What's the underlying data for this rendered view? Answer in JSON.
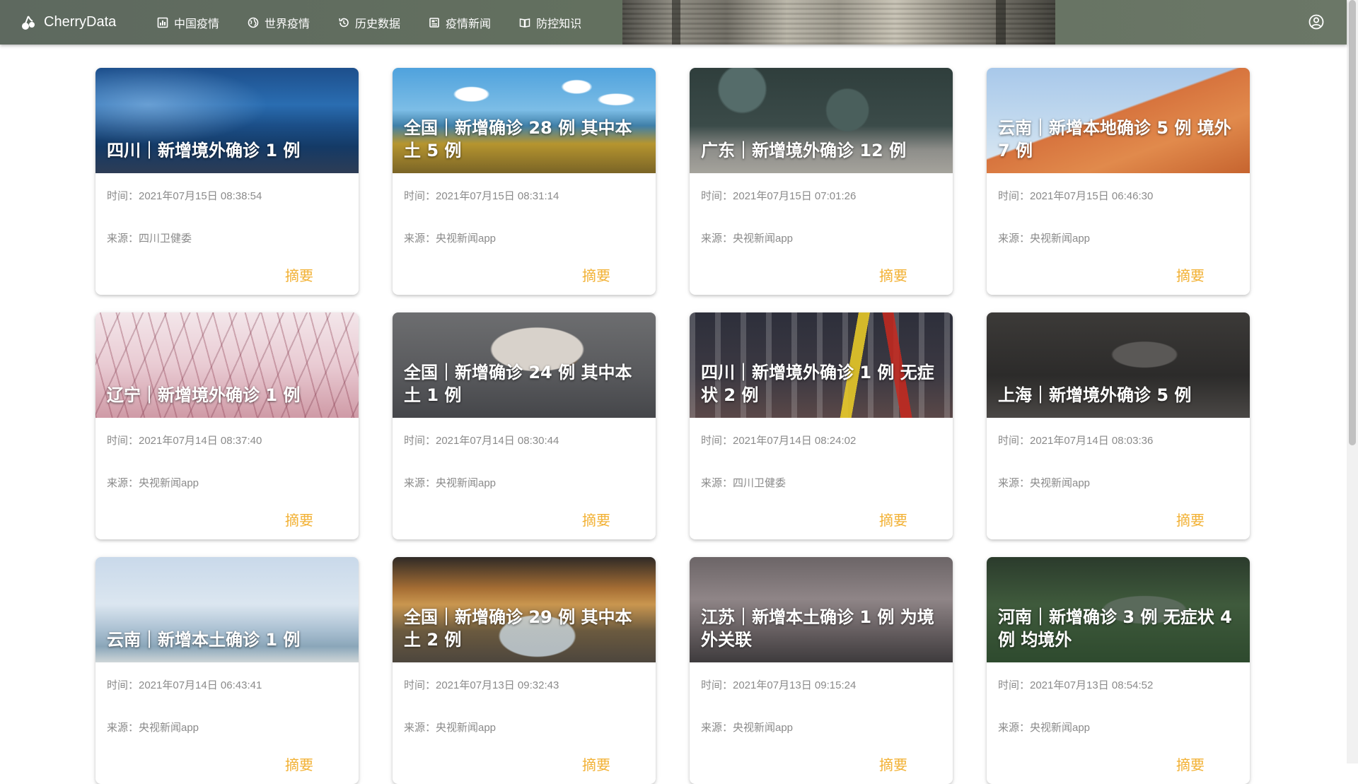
{
  "app": {
    "name": "CherryData"
  },
  "nav": [
    {
      "label": "中国疫情",
      "icon": "chart-icon"
    },
    {
      "label": "世界疫情",
      "icon": "globe-icon"
    },
    {
      "label": "历史数据",
      "icon": "history-icon"
    },
    {
      "label": "疫情新闻",
      "icon": "newspaper-icon"
    },
    {
      "label": "防控知识",
      "icon": "book-icon"
    }
  ],
  "account": {
    "icon": "account-circle-icon"
  },
  "labels": {
    "time_prefix": "时间：",
    "source_prefix": "来源：",
    "action": "摘要"
  },
  "cards": [
    {
      "title": "四川｜新增境外确诊 1 例",
      "time": "时间：2021年07月15日 08:38:54",
      "source": "来源：四川卫健委",
      "action": "摘要",
      "image": "bg-sea"
    },
    {
      "title": "全国｜新增确诊 28 例 其中本土 5 例",
      "time": "时间：2021年07月15日 08:31:14",
      "source": "来源：央视新闻app",
      "action": "摘要",
      "image": "bg-grass"
    },
    {
      "title": "广东｜新增境外确诊 12 例",
      "time": "时间：2021年07月15日 07:01:26",
      "source": "来源：央视新闻app",
      "action": "摘要",
      "image": "bg-dark"
    },
    {
      "title": "云南｜新增本地确诊 5 例 境外 7 例",
      "time": "时间：2021年07月15日 06:46:30",
      "source": "来源：央视新闻app",
      "action": "摘要",
      "image": "bg-desert"
    },
    {
      "title": "辽宁｜新增境外确诊 1 例",
      "time": "时间：2021年07月14日 08:37:40",
      "source": "来源：央视新闻app",
      "action": "摘要",
      "image": "bg-blossom"
    },
    {
      "title": "全国｜新增确诊 24 例 其中本土 1 例",
      "time": "时间：2021年07月14日 08:30:44",
      "source": "来源：央视新闻app",
      "action": "摘要",
      "image": "bg-dog"
    },
    {
      "title": "四川｜新增境外确诊 1 例 无症状 2 例",
      "time": "时间：2021年07月14日 08:24:02",
      "source": "来源：四川卫健委",
      "action": "摘要",
      "image": "bg-city"
    },
    {
      "title": "上海｜新增境外确诊 5 例",
      "time": "时间：2021年07月14日 08:03:36",
      "source": "来源：央视新闻app",
      "action": "摘要",
      "image": "bg-camera"
    },
    {
      "title": "云南｜新增本土确诊 1 例",
      "time": "时间：2021年07月14日 06:43:41",
      "source": "来源：央视新闻app",
      "action": "摘要",
      "image": "bg-beach"
    },
    {
      "title": "全国｜新增确诊 29 例 其中本土 2 例",
      "time": "时间：2021年07月13日 09:32:43",
      "source": "来源：央视新闻app",
      "action": "摘要",
      "image": "bg-road"
    },
    {
      "title": "江苏｜新增本土确诊 1 例 为境外关联",
      "time": "时间：2021年07月13日 09:15:24",
      "source": "来源：央视新闻app",
      "action": "摘要",
      "image": "bg-bridge"
    },
    {
      "title": "河南｜新增确诊 3 例 无症状 4 例 均境外",
      "time": "时间：2021年07月13日 08:54:52",
      "source": "来源：央视新闻app",
      "action": "摘要",
      "image": "bg-forest"
    }
  ]
}
